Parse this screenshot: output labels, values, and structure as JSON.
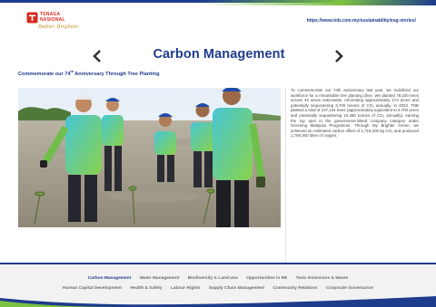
{
  "brand": {
    "name_line1": "TENAGA",
    "name_line2": "NASIONAL",
    "tagline": "Better. Brighter."
  },
  "header": {
    "url": "https://www.tnb.com.my/sustainability/esg-stories/"
  },
  "page": {
    "title": "Carbon Management",
    "subtitle_prefix": "Commemorate our 74",
    "subtitle_sup": "th",
    "subtitle_suffix": " Anniversary Through Tree Planting",
    "paragraph": "To commemorate our 74th anniversary last year, we mobilized our workforce for a remarkable tree planting drive. We planted 78,100 trees across 42 areas nationwide, reforesting approximately 174 acres and potentially sequestering 3,700 tonnes of CO₂ annually. In 2023, TNB planted a total of 247,104 trees (approximately equivalent to 6,700 acres and potentially sequestering 10,480 tonnes of CO₂ annually), earning the top spot in the government-linked company category under Greening Malaysia Programme. Through My Brighter Green, we achieved an estimated carbon offset of 1,718,200 kg CO₂ and produced 1,769,300 litres of oxygen."
  },
  "navigation": {
    "prev_icon": "chevron-left-icon",
    "next_icon": "chevron-right-icon"
  },
  "footer": {
    "row1": [
      "Carbon Management",
      "Water Management",
      "Biodiversity & Land Use",
      "Opportunities in RE",
      "Toxic Emissions & Waste"
    ],
    "row2": [
      "Human Capital Development",
      "Health & Safety",
      "Labour Rights",
      "Supply Chain Management",
      "Community Relations",
      "Corporate Governance"
    ]
  },
  "colors": {
    "brand_blue": "#1e3c8c",
    "brand_red": "#d72c20",
    "brand_green": "#7cc142"
  }
}
